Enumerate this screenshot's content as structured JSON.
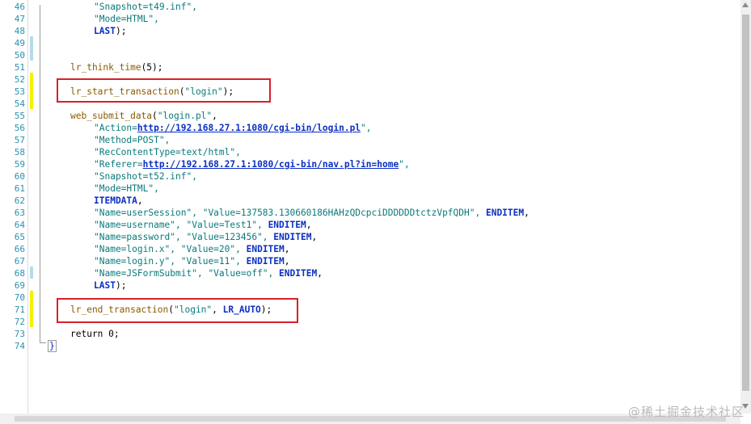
{
  "lines": [
    {
      "n": "46",
      "t": [
        {
          "c": "str",
          "v": "\"Snapshot=t49.inf\","
        }
      ]
    },
    {
      "n": "47",
      "t": [
        {
          "c": "str",
          "v": "\"Mode=HTML\","
        }
      ]
    },
    {
      "n": "48",
      "t": [
        {
          "c": "kw",
          "v": "LAST"
        },
        {
          "c": "plain",
          "v": ");"
        }
      ]
    },
    {
      "n": "49",
      "t": []
    },
    {
      "n": "50",
      "t": []
    },
    {
      "n": "51",
      "t": [
        {
          "c": "fn",
          "v": "lr_think_time"
        },
        {
          "c": "plain",
          "v": "(5);"
        }
      ]
    },
    {
      "n": "52",
      "t": []
    },
    {
      "n": "53",
      "t": [
        {
          "c": "fn",
          "v": "lr_start_transaction"
        },
        {
          "c": "plain",
          "v": "("
        },
        {
          "c": "str",
          "v": "\"login\""
        },
        {
          "c": "plain",
          "v": ");"
        }
      ]
    },
    {
      "n": "54",
      "t": []
    },
    {
      "n": "55",
      "t": [
        {
          "c": "fn",
          "v": "web_submit_data"
        },
        {
          "c": "plain",
          "v": "("
        },
        {
          "c": "str",
          "v": "\"login.pl\""
        },
        {
          "c": "plain",
          "v": ","
        }
      ]
    },
    {
      "n": "56",
      "t": [
        {
          "c": "str",
          "v": "\"Action="
        },
        {
          "c": "url",
          "v": "http://192.168.27.1:1080/cgi-bin/login.pl"
        },
        {
          "c": "str",
          "v": "\","
        }
      ]
    },
    {
      "n": "57",
      "t": [
        {
          "c": "str",
          "v": "\"Method=POST\","
        }
      ]
    },
    {
      "n": "58",
      "t": [
        {
          "c": "str",
          "v": "\"RecContentType=text/html\","
        }
      ]
    },
    {
      "n": "59",
      "t": [
        {
          "c": "str",
          "v": "\"Referer="
        },
        {
          "c": "url",
          "v": "http://192.168.27.1:1080/cgi-bin/nav.pl?in=home"
        },
        {
          "c": "str",
          "v": "\","
        }
      ]
    },
    {
      "n": "60",
      "t": [
        {
          "c": "str",
          "v": "\"Snapshot=t52.inf\","
        }
      ]
    },
    {
      "n": "61",
      "t": [
        {
          "c": "str",
          "v": "\"Mode=HTML\","
        }
      ]
    },
    {
      "n": "62",
      "t": [
        {
          "c": "kw",
          "v": "ITEMDATA"
        },
        {
          "c": "plain",
          "v": ","
        }
      ]
    },
    {
      "n": "63",
      "t": [
        {
          "c": "str",
          "v": "\"Name=userSession\", \"Value=137583.130660186HAHzQDcpciDDDDDDtctzVpfQDH\","
        },
        {
          "c": "plain",
          "v": " "
        },
        {
          "c": "kw",
          "v": "ENDITEM"
        },
        {
          "c": "plain",
          "v": ","
        }
      ]
    },
    {
      "n": "64",
      "t": [
        {
          "c": "str",
          "v": "\"Name=username\", \"Value=Test1\","
        },
        {
          "c": "plain",
          "v": " "
        },
        {
          "c": "kw",
          "v": "ENDITEM"
        },
        {
          "c": "plain",
          "v": ","
        }
      ]
    },
    {
      "n": "65",
      "t": [
        {
          "c": "str",
          "v": "\"Name=password\", \"Value=123456\","
        },
        {
          "c": "plain",
          "v": " "
        },
        {
          "c": "kw",
          "v": "ENDITEM"
        },
        {
          "c": "plain",
          "v": ","
        }
      ]
    },
    {
      "n": "66",
      "t": [
        {
          "c": "str",
          "v": "\"Name=login.x\", \"Value=20\","
        },
        {
          "c": "plain",
          "v": " "
        },
        {
          "c": "kw",
          "v": "ENDITEM"
        },
        {
          "c": "plain",
          "v": ","
        }
      ]
    },
    {
      "n": "67",
      "t": [
        {
          "c": "str",
          "v": "\"Name=login.y\", \"Value=11\","
        },
        {
          "c": "plain",
          "v": " "
        },
        {
          "c": "kw",
          "v": "ENDITEM"
        },
        {
          "c": "plain",
          "v": ","
        }
      ]
    },
    {
      "n": "68",
      "t": [
        {
          "c": "str",
          "v": "\"Name=JSFormSubmit\", \"Value=off\","
        },
        {
          "c": "plain",
          "v": " "
        },
        {
          "c": "kw",
          "v": "ENDITEM"
        },
        {
          "c": "plain",
          "v": ","
        }
      ]
    },
    {
      "n": "69",
      "t": [
        {
          "c": "kw",
          "v": "LAST"
        },
        {
          "c": "plain",
          "v": ");"
        }
      ]
    },
    {
      "n": "70",
      "t": []
    },
    {
      "n": "71",
      "t": [
        {
          "c": "fn",
          "v": "lr_end_transaction"
        },
        {
          "c": "plain",
          "v": "("
        },
        {
          "c": "str",
          "v": "\"login\""
        },
        {
          "c": "plain",
          "v": ", "
        },
        {
          "c": "kw",
          "v": "LR_AUTO"
        },
        {
          "c": "plain",
          "v": ");"
        }
      ]
    },
    {
      "n": "72",
      "t": []
    },
    {
      "n": "73",
      "t": [
        {
          "c": "plain",
          "v": "return 0;"
        }
      ]
    },
    {
      "n": "74",
      "t": [
        {
          "c": "brace",
          "v": "}"
        }
      ]
    }
  ],
  "watermark": "@稀土掘金技术社区",
  "colors": {
    "highlight_box": "#d8202a",
    "line_number": "#2b91af",
    "keyword": "#0b2fc4",
    "string": "#0a7a7a",
    "function": "#8b5a00"
  }
}
